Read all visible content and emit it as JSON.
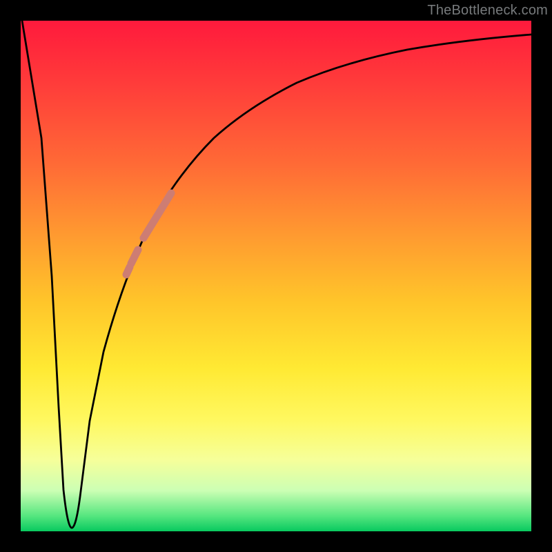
{
  "watermark": "TheBottleneck.com",
  "colors": {
    "frame": "#000000",
    "curve": "#000000",
    "marker": "#cd7d73",
    "gradient_top": "#ff1a3c",
    "gradient_bottom": "#08c95f"
  },
  "chart_data": {
    "type": "line",
    "title": "",
    "xlabel": "",
    "ylabel": "",
    "xlim": [
      0,
      100
    ],
    "ylim": [
      0,
      100
    ],
    "grid": false,
    "legend": false,
    "series": [
      {
        "name": "bottleneck-curve",
        "x": [
          0,
          3,
          5,
          7,
          9,
          10,
          11,
          13,
          15,
          18,
          22,
          26,
          30,
          34,
          38,
          44,
          50,
          58,
          66,
          74,
          82,
          90,
          100
        ],
        "y": [
          100,
          70,
          40,
          12,
          2,
          1,
          3,
          12,
          24,
          38,
          50,
          59,
          65,
          70,
          74,
          79,
          83,
          87,
          90,
          92,
          93.5,
          94.5,
          95.5
        ]
      }
    ],
    "markers": [
      {
        "name": "highlight-segment-upper",
        "x_range": [
          24,
          29
        ],
        "y_range": [
          55,
          64
        ]
      },
      {
        "name": "highlight-segment-lower",
        "x_range": [
          21.5,
          23.5
        ],
        "y_range": [
          48,
          53
        ]
      }
    ]
  }
}
